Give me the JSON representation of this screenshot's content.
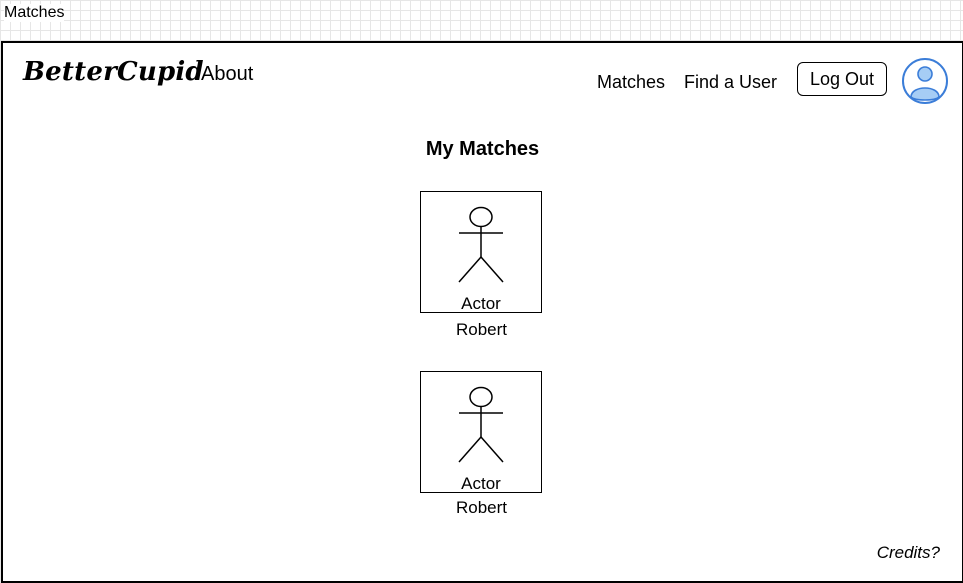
{
  "page": {
    "label": "Matches"
  },
  "header": {
    "logo": "BetterCupid",
    "about": "About",
    "nav": {
      "matches": "Matches",
      "find_user": "Find a User"
    },
    "logout_label": "Log Out",
    "avatar_icon": "user-avatar-icon",
    "avatar_color": "#5aa0e6"
  },
  "main": {
    "title": "My Matches",
    "matches": [
      {
        "image_label": "Actor",
        "name": "Robert"
      },
      {
        "image_label": "Actor",
        "name": "Robert"
      }
    ]
  },
  "footer": {
    "credits": "Credits?"
  }
}
